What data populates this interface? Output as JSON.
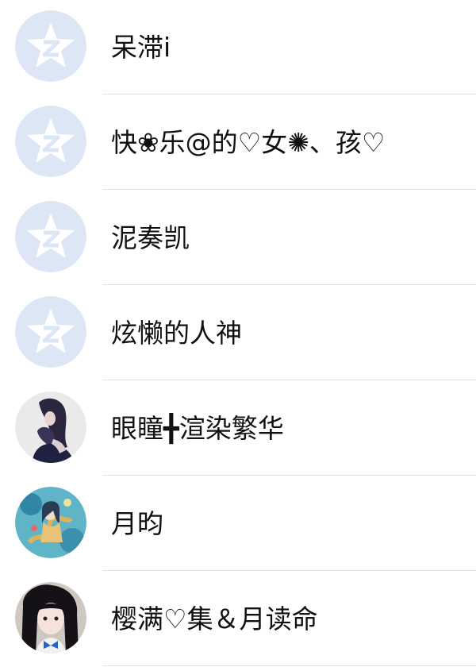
{
  "contacts": [
    {
      "name": "呆滞i",
      "avatar": "default-qq-star-icon"
    },
    {
      "name": "快❀乐@的♡女✺、孩♡",
      "avatar": "default-qq-star-icon"
    },
    {
      "name": "泥奏凯",
      "avatar": "default-qq-star-icon"
    },
    {
      "name": "炫懒的人神",
      "avatar": "default-qq-star-icon"
    },
    {
      "name": "眼瞳╋渲染繁华",
      "avatar": "photo-girl-dark-hair"
    },
    {
      "name": "月昀",
      "avatar": "anime-illustration"
    },
    {
      "name": "樱满♡集＆月读命",
      "avatar": "photo-cosplay-girl"
    }
  ],
  "colors": {
    "default_avatar_bg": "#dce6f4",
    "divider": "#e0e0e0",
    "text": "#111111"
  }
}
